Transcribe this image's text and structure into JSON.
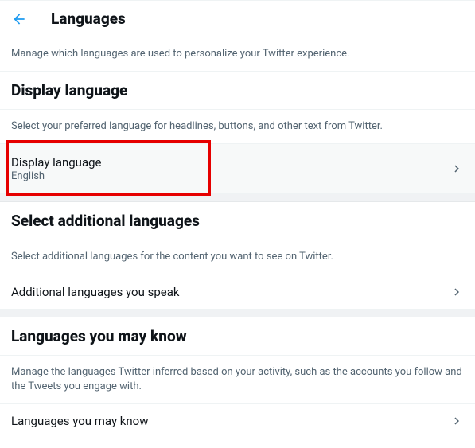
{
  "header": {
    "title": "Languages"
  },
  "intro": {
    "description": "Manage which languages are used to personalize your Twitter experience."
  },
  "sections": {
    "display": {
      "title": "Display language",
      "description": "Select your preferred language for headlines, buttons, and other text from Twitter.",
      "row": {
        "label": "Display language",
        "value": "English"
      }
    },
    "additional": {
      "title": "Select additional languages",
      "description": "Select additional languages for the content you want to see on Twitter.",
      "row": {
        "label": "Additional languages you speak"
      }
    },
    "may_know": {
      "title": "Languages you may know",
      "description": "Manage the languages Twitter inferred based on your activity, such as the accounts you follow and the Tweets you engage with.",
      "row": {
        "label": "Languages you may know"
      }
    }
  }
}
